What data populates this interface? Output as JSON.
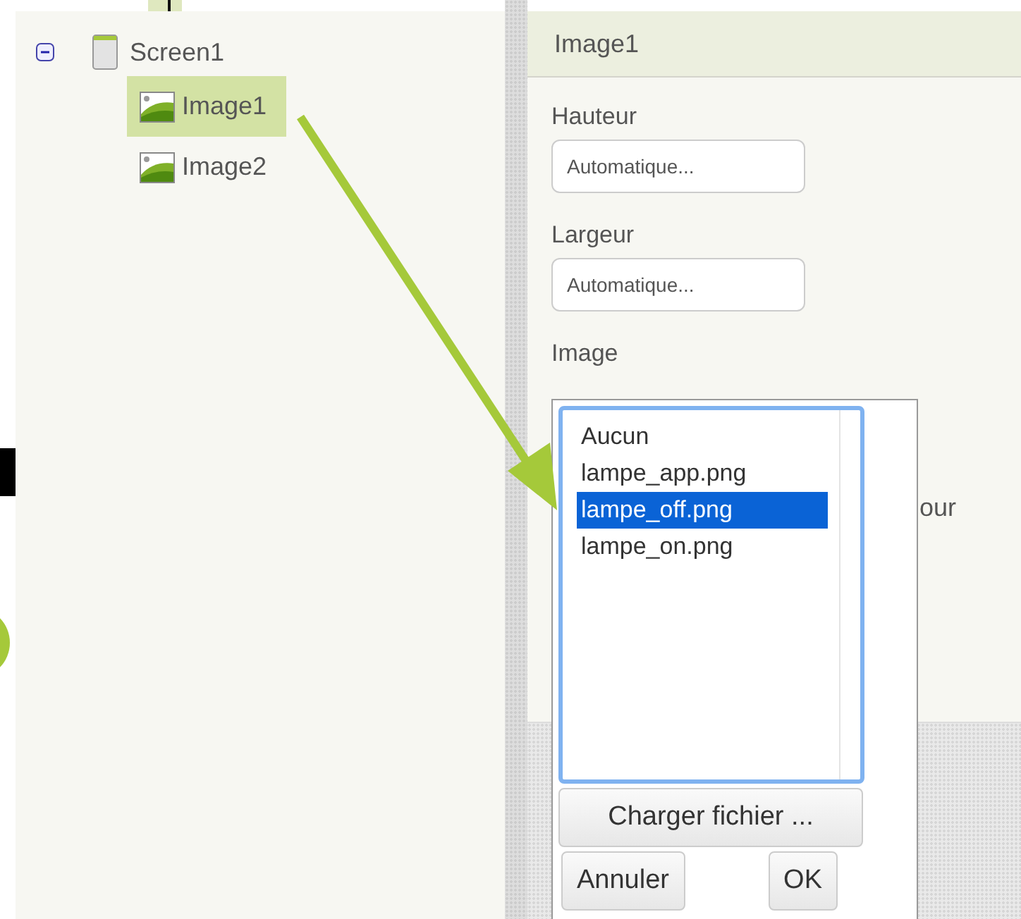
{
  "tree": {
    "items": [
      {
        "label": "Screen1",
        "kind": "screen",
        "expanded": true,
        "children": [
          {
            "label": "Image1",
            "kind": "image",
            "selected": true
          },
          {
            "label": "Image2",
            "kind": "image",
            "selected": false
          }
        ]
      }
    ]
  },
  "properties": {
    "title": "Image1",
    "fields": [
      {
        "label": "Hauteur",
        "value": "Automatique..."
      },
      {
        "label": "Largeur",
        "value": "Automatique..."
      }
    ],
    "image_label": "Image",
    "partial_text": "our"
  },
  "picker": {
    "options": [
      {
        "label": "Aucun",
        "selected": false
      },
      {
        "label": "lampe_app.png",
        "selected": false
      },
      {
        "label": "lampe_off.png",
        "selected": true
      },
      {
        "label": "lampe_on.png",
        "selected": false
      }
    ],
    "upload_button": "Charger fichier ...",
    "buttons": [
      "Annuler",
      "OK"
    ]
  }
}
